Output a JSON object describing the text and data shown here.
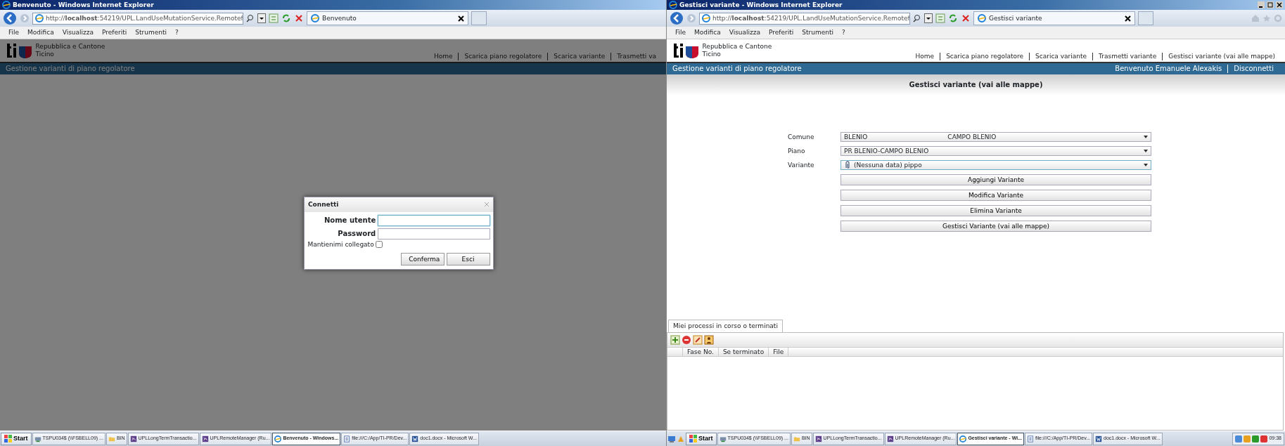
{
  "windows": [
    {
      "title": "Benvenuto - Windows Internet Explorer",
      "controls": false,
      "address": "http://**localhost**:54219/UPL.LandUseMutationService.Remotef",
      "tab": "Benvenuto",
      "menu": [
        "File",
        "Modifica",
        "Visualizza",
        "Preferiti",
        "Strumenti",
        "?"
      ],
      "org": [
        "Repubblica e Cantone",
        "Ticino"
      ],
      "nav": [
        "Home",
        "Scarica piano regolatore",
        "Scarica variante",
        "Trasmetti va"
      ],
      "banner": "Gestione varianti di piano regolatore",
      "dimmed": true,
      "dialog": {
        "title": "Connetti",
        "fields": [
          {
            "label": "Nome utente",
            "focused": true
          },
          {
            "label": "Password",
            "focused": false
          }
        ],
        "checkbox": {
          "label": "Mantienimi collegato",
          "checked": false
        },
        "buttons": [
          "Conferma",
          "Esci"
        ]
      },
      "taskbar": {
        "quick_launch": false,
        "start": "Start",
        "items": [
          {
            "label": "TSPU034$ (\\\\FSBELL09) ...",
            "kind": "drive",
            "selected": false
          },
          {
            "label": "BIN",
            "kind": "folder",
            "selected": false
          },
          {
            "label": "UPLLongTermTransactio...",
            "kind": "studio",
            "selected": false
          },
          {
            "label": "UPLRemoteManager (Ru...",
            "kind": "studio",
            "selected": false
          },
          {
            "label": "Benvenuto - Windows...",
            "kind": "browser",
            "selected": true
          },
          {
            "label": "file:///C:/App/TI-PR/Dev...",
            "kind": "file",
            "selected": false
          },
          {
            "label": "doc1.docx - Microsoft W...",
            "kind": "word",
            "selected": false
          }
        ]
      }
    },
    {
      "title": "Gestisci variante - Windows Internet Explorer",
      "controls": true,
      "address": "http://**localhost**:54219/UPL.LandUseMutationService.Remotef",
      "tab": "Gestisci variante",
      "menu": [
        "File",
        "Modifica",
        "Visualizza",
        "Preferiti",
        "Strumenti",
        "?"
      ],
      "org": [
        "Repubblica e Cantone",
        "Ticino"
      ],
      "nav": [
        "Home",
        "Scarica piano regolatore",
        "Scarica variante",
        "Trasmetti variante",
        "Gestisci variante (vai alle mappe)"
      ],
      "banner": "Gestione varianti di piano regolatore",
      "user_links": [
        "Benvenuto Emanuele Alexakis",
        "Disconnetti"
      ],
      "dimmed": false,
      "page": {
        "heading": "Gestisci variante (vai alle mappe)",
        "fields": [
          {
            "label": "Comune",
            "kind": "plain",
            "values": [
              "BLENIO",
              "CAMPO BLENIO"
            ],
            "focused": false
          },
          {
            "label": "Piano",
            "kind": "plain",
            "values": [
              "PR BLENIO-CAMPO BLENIO"
            ],
            "focused": false
          },
          {
            "label": "Variante",
            "kind": "tagged",
            "values": [
              "(Nessuna data) pippo"
            ],
            "focused": true
          }
        ],
        "buttons": [
          "Aggiungi Variante",
          "Modifica Variante",
          "Elimina Variante",
          "Gestisci Variante (vai alle mappe)"
        ],
        "panel": {
          "tabs": [
            {
              "label": "Miei processi in corso o terminati",
              "selected": true
            }
          ],
          "columns": [
            "Fase No.",
            "Se terminato",
            "File"
          ]
        }
      },
      "taskbar": {
        "quick_launch": true,
        "start": "Start",
        "items": [
          {
            "label": "TSPU034$ (\\\\FSBELL09) ...",
            "kind": "drive",
            "selected": false
          },
          {
            "label": "BIN",
            "kind": "folder",
            "selected": false
          },
          {
            "label": "UPLLongTermTransactio...",
            "kind": "studio",
            "selected": false
          },
          {
            "label": "UPLRemoteManager (Ru...",
            "kind": "studio",
            "selected": false
          },
          {
            "label": "Gestisci variante - Wi...",
            "kind": "browser",
            "selected": true
          },
          {
            "label": "file:///C:/App/TI-PR/Dev...",
            "kind": "file",
            "selected": false
          },
          {
            "label": "doc1.docx - Microsoft W...",
            "kind": "word",
            "selected": false
          }
        ],
        "clock": "09:38"
      }
    }
  ]
}
